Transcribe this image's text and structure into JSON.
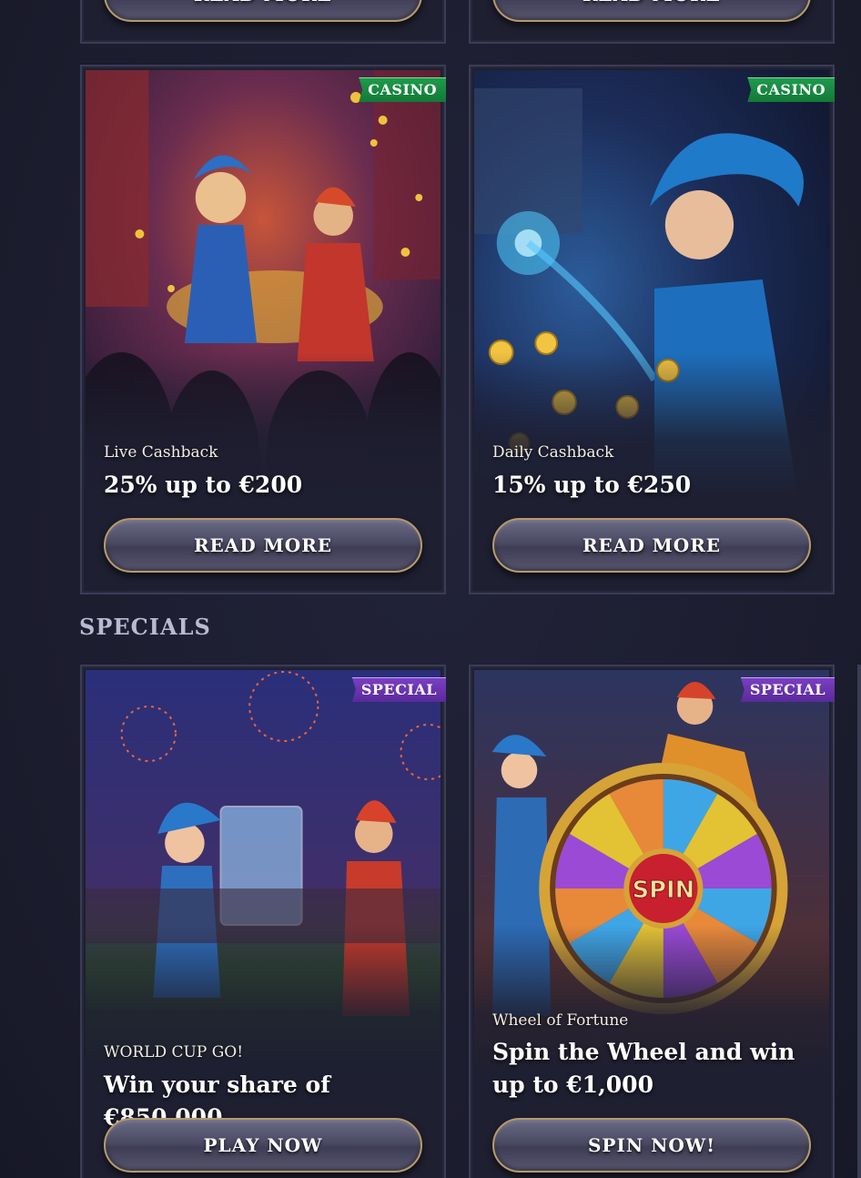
{
  "top_row": {
    "left_button": "READ MORE",
    "right_button": "READ MORE"
  },
  "cards_casino": [
    {
      "badge": "CASINO",
      "subtitle": "Live Cashback",
      "headline": "25% up to €200",
      "button": "READ MORE"
    },
    {
      "badge": "CASINO",
      "subtitle": "Daily Cashback",
      "headline": "15% up to €250",
      "button": "READ MORE"
    }
  ],
  "specials_section": {
    "title": "SPECIALS"
  },
  "cards_special": [
    {
      "badge": "SPECIAL",
      "subtitle": "WORLD CUP GO!",
      "headline": "Win your share of €850,000",
      "button": "PLAY NOW"
    },
    {
      "badge": "SPECIAL",
      "subtitle": "Wheel of Fortune",
      "headline": "Spin the Wheel and win up to €1,000",
      "button": "SPIN NOW!",
      "wheel_label": "SPIN"
    }
  ],
  "colors": {
    "background": "#1c1d2f",
    "card_border": "#3b3c55",
    "casino_badge": "#1f9a4c",
    "special_badge": "#7a3fc2",
    "button_border": "#b79a6a"
  }
}
